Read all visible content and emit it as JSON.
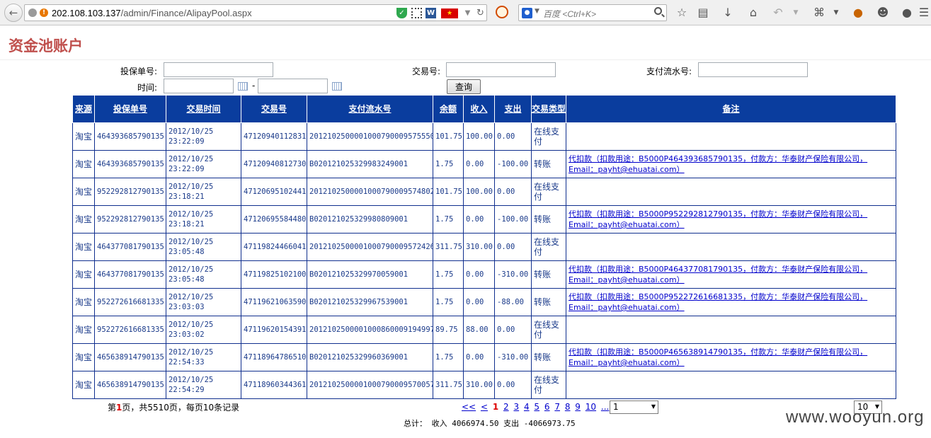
{
  "browser": {
    "url_host": "202.108.103.137",
    "url_path": "/admin/Finance/AlipayPool.aspx",
    "search_placeholder": "百度 <Ctrl+K>"
  },
  "page": {
    "title": "资金池账户"
  },
  "filters": {
    "policy_no_label": "投保单号:",
    "trade_no_label": "交易号:",
    "payment_serial_label": "支付流水号:",
    "time_label": "时间:",
    "time_separator": "-",
    "query_button": "查询"
  },
  "table": {
    "headers": [
      "来源",
      "投保单号",
      "交易时间",
      "交易号",
      "支付流水号",
      "余额",
      "收入",
      "支出",
      "交易类型",
      "备注"
    ],
    "rows": [
      {
        "source": "淘宝",
        "policy": "464393685790135",
        "time": "2012/10/25 23:22:09",
        "trade": "47120940112831",
        "serial": "2012102500001000790009575550",
        "balance": "101.75",
        "income": "100.00",
        "expense": "0.00",
        "type": "在线支付",
        "note": ""
      },
      {
        "source": "淘宝",
        "policy": "464393685790135",
        "time": "2012/10/25 23:22:09",
        "trade": "47120940812730",
        "serial": "B020121025329983249001",
        "balance": "1.75",
        "income": "0.00",
        "expense": "-100.00",
        "type": "转账",
        "note": "代扣款（扣款用途：B5000P464393685790135，付款方：华泰财产保险有限公司，Email：payht@ehuatai.com）"
      },
      {
        "source": "淘宝",
        "policy": "952292812790135",
        "time": "2012/10/25 23:18:21",
        "trade": "47120695102441",
        "serial": "2012102500001000790009574802",
        "balance": "101.75",
        "income": "100.00",
        "expense": "0.00",
        "type": "在线支付",
        "note": ""
      },
      {
        "source": "淘宝",
        "policy": "952292812790135",
        "time": "2012/10/25 23:18:21",
        "trade": "47120695584480",
        "serial": "B020121025329980809001",
        "balance": "1.75",
        "income": "0.00",
        "expense": "-100.00",
        "type": "转账",
        "note": "代扣款（扣款用途：B5000P952292812790135，付款方：华泰财产保险有限公司，Email：payht@ehuatai.com）"
      },
      {
        "source": "淘宝",
        "policy": "464377081790135",
        "time": "2012/10/25 23:05:48",
        "trade": "47119824466041",
        "serial": "2012102500001000790009572426",
        "balance": "311.75",
        "income": "310.00",
        "expense": "0.00",
        "type": "在线支付",
        "note": ""
      },
      {
        "source": "淘宝",
        "policy": "464377081790135",
        "time": "2012/10/25 23:05:48",
        "trade": "47119825102100",
        "serial": "B020121025329970059001",
        "balance": "1.75",
        "income": "0.00",
        "expense": "-310.00",
        "type": "转账",
        "note": "代扣款（扣款用途：B5000P464377081790135，付款方：华泰财产保险有限公司，Email：payht@ehuatai.com）"
      },
      {
        "source": "淘宝",
        "policy": "952272616681335",
        "time": "2012/10/25 23:03:03",
        "trade": "47119621063590",
        "serial": "B020121025329967539001",
        "balance": "1.75",
        "income": "0.00",
        "expense": "-88.00",
        "type": "转账",
        "note": "代扣款（扣款用途：B5000P952272616681335，付款方：华泰财产保险有限公司，Email：payht@ehuatai.com）"
      },
      {
        "source": "淘宝",
        "policy": "952272616681335",
        "time": "2012/10/25 23:03:02",
        "trade": "47119620154391",
        "serial": "2012102500001000860009194997",
        "balance": "89.75",
        "income": "88.00",
        "expense": "0.00",
        "type": "在线支付",
        "note": ""
      },
      {
        "source": "淘宝",
        "policy": "465638914790135",
        "time": "2012/10/25 22:54:33",
        "trade": "47118964786510",
        "serial": "B020121025329960369001",
        "balance": "1.75",
        "income": "0.00",
        "expense": "-310.00",
        "type": "转账",
        "note": "代扣款（扣款用途：B5000P465638914790135，付款方：华泰财产保险有限公司，Email：payht@ehuatai.com）"
      },
      {
        "source": "淘宝",
        "policy": "465638914790135",
        "time": "2012/10/25 22:54:29",
        "trade": "47118960344361",
        "serial": "2012102500001000790009570057",
        "balance": "311.75",
        "income": "310.00",
        "expense": "0.00",
        "type": "在线支付",
        "note": ""
      }
    ]
  },
  "pagination": {
    "info_prefix": "第",
    "current_page": "1",
    "info_suffix": "页，共5510页，每页10条记录",
    "first": "<<",
    "prev": "<",
    "pages": [
      "1",
      "2",
      "3",
      "4",
      "5",
      "6",
      "7",
      "8",
      "9",
      "10"
    ],
    "more": "...",
    "next": ">",
    "last": ">>",
    "page_select_value": "1",
    "page_size_value": "10"
  },
  "totals": {
    "text": "总计： 收入 4066974.50 支出 -4066973.75"
  },
  "watermark": "www.wooyun.org"
}
